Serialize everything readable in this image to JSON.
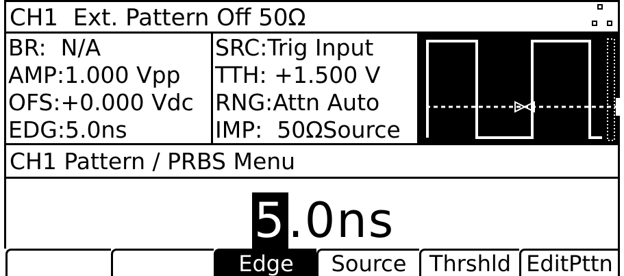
{
  "header": {
    "channel": "CH1",
    "mode_text": "Ext. Pattern Off 50Ω"
  },
  "params_left": [
    {
      "label": "BR:",
      "value": "N/A"
    },
    {
      "label": "AMP:",
      "value": "1.000 Vpp"
    },
    {
      "label": "OFS:",
      "value": "+0.000 Vdc"
    },
    {
      "label": "EDG:",
      "value": "5.0ns"
    }
  ],
  "params_right": [
    {
      "label": "SRC:",
      "value": "Trig Input"
    },
    {
      "label": "TTH:",
      "value": "+1.500 V"
    },
    {
      "label": "RNG:",
      "value": "Attn Auto"
    },
    {
      "label": "IMP:",
      "value": "50ΩSource"
    }
  ],
  "scope": {
    "waveform": "square-pattern",
    "trigger_marker_icon": "trigger-level-arrows-icon",
    "background": "#000000",
    "trace_color": "#ffffff"
  },
  "menu": {
    "title": "CH1 Pattern / PRBS Menu"
  },
  "value_display": {
    "cursor_digit": "5",
    "rest": ".0ns"
  },
  "softkeys": [
    {
      "label": "",
      "selected": false
    },
    {
      "label": "",
      "selected": false
    },
    {
      "label": "Edge",
      "selected": true
    },
    {
      "label": "Source",
      "selected": false
    },
    {
      "label": "Thrshld",
      "selected": false
    },
    {
      "label": "EditPttn",
      "selected": false
    }
  ],
  "colors": {
    "foreground": "#000000",
    "background": "#ffffff"
  }
}
